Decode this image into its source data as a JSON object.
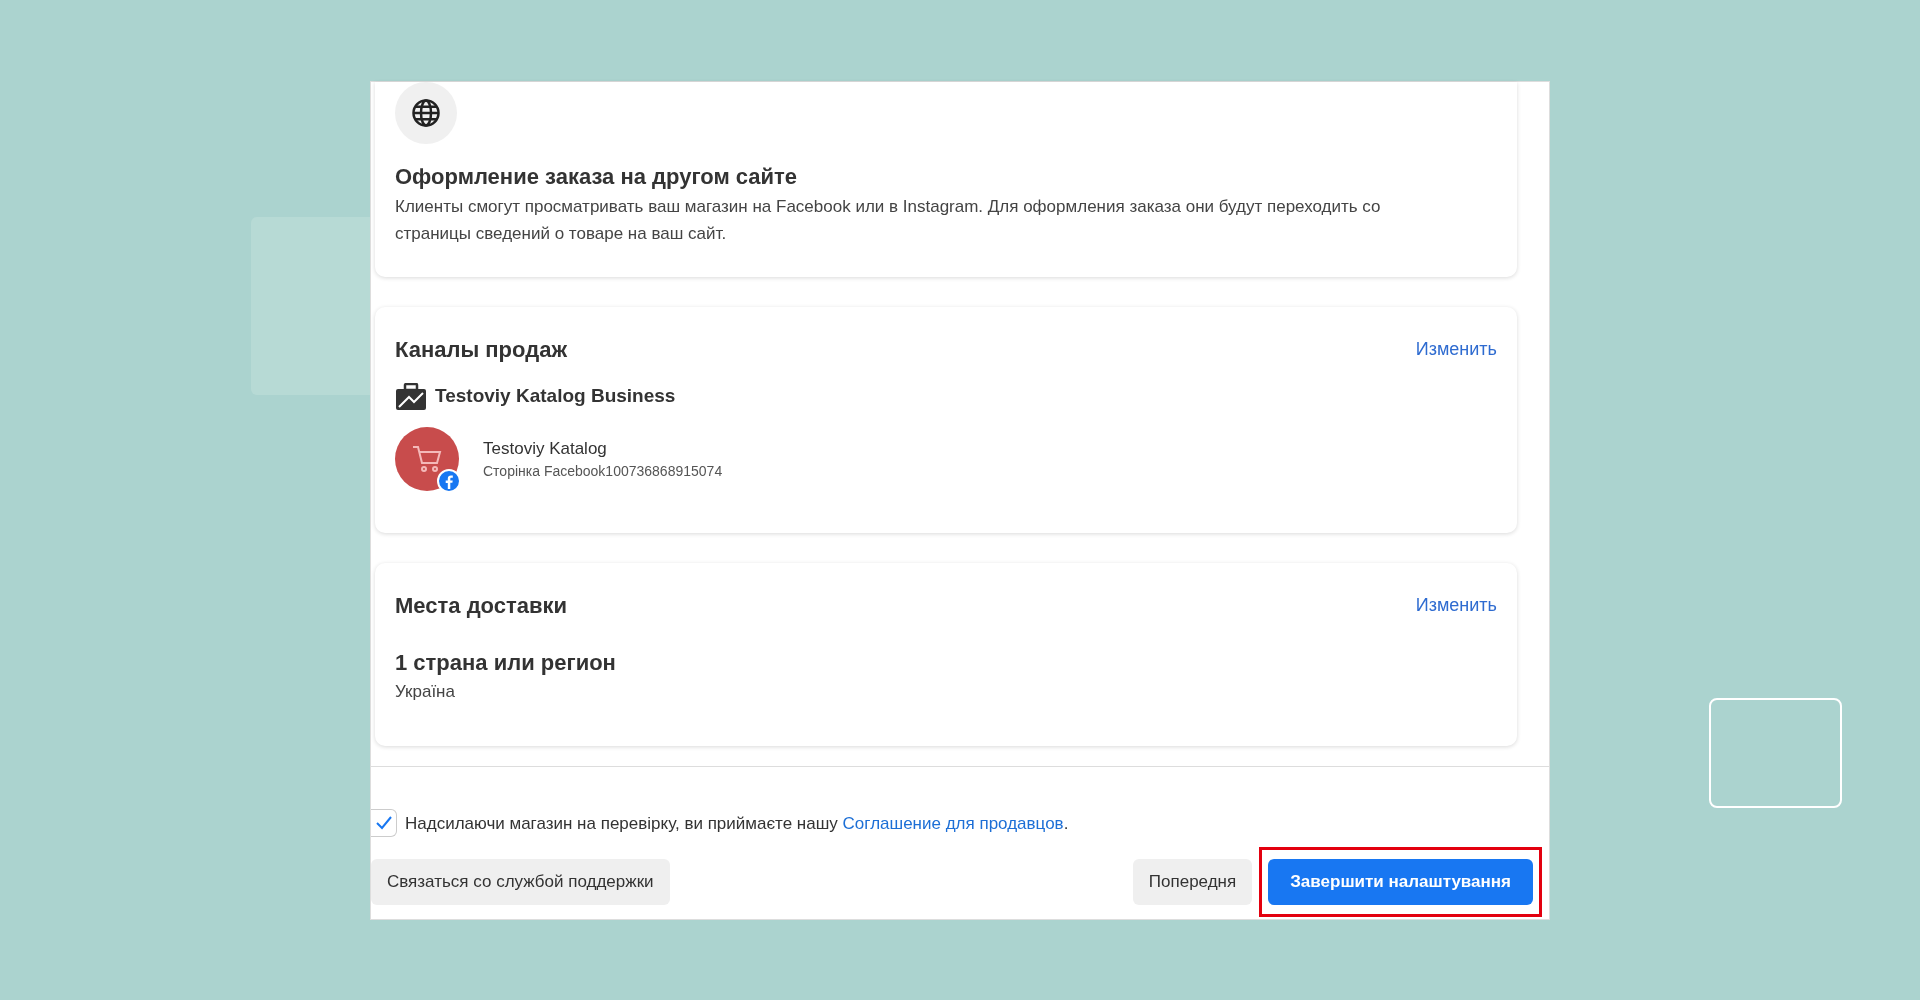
{
  "checkout_card": {
    "title": "Оформление заказа на другом сайте",
    "description": "Клиенты смогут просматривать ваш магазин на Facebook или в Instagram. Для оформления заказа они будут переходить со страницы сведений о товаре на ваш сайт."
  },
  "sales_channels": {
    "title": "Каналы продаж",
    "edit_link": "Изменить",
    "business_name": "Testoviy Katalog Business",
    "page": {
      "name": "Testoviy Katalog",
      "subtitle": "Сторінка Facebook100736868915074"
    }
  },
  "delivery": {
    "title": "Места доставки",
    "edit_link": "Изменить",
    "summary": "1 страна или регион",
    "country": "Україна"
  },
  "agreement": {
    "checked": true,
    "text": "Надсилаючи магазин на перевірку, ви приймаєте нашу",
    "link": "Соглашение для продавцов",
    "after": "."
  },
  "support_button": {
    "label": "Связаться со службой поддержки"
  },
  "buttons": [
    {
      "label": "Попередня",
      "kind": "secondary",
      "highlighted": false
    },
    {
      "label": "Завершити налаштування",
      "kind": "primary",
      "highlighted": true
    }
  ]
}
